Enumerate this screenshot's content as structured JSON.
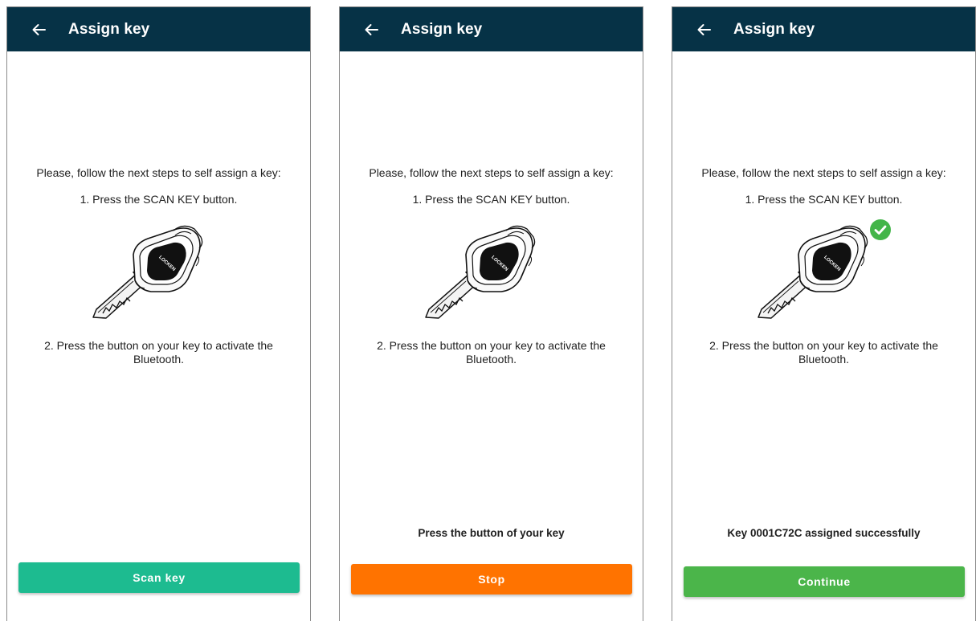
{
  "screens": [
    {
      "title": "Assign key",
      "intro": "Please, follow the next steps to self assign a key:",
      "step1": "1. Press the SCAN KEY button.",
      "step2": "2. Press the button on your key to activate the Bluetooth.",
      "key_brand": "LOCKEN",
      "status": "",
      "button_label": "Scan key"
    },
    {
      "title": "Assign key",
      "intro": "Please, follow the next steps to self assign a key:",
      "step1": "1. Press the SCAN KEY button.",
      "step2": "2. Press the button on your key to activate the Bluetooth.",
      "key_brand": "LOCKEN",
      "status": "Press the button of your key",
      "button_label": "Stop"
    },
    {
      "title": "Assign key",
      "intro": "Please, follow the next steps to self assign a key:",
      "step1": "1. Press the SCAN KEY button.",
      "step2": "2. Press the button on your key to activate the Bluetooth.",
      "key_brand": "LOCKEN",
      "status": "Key 0001C72C assigned successfully",
      "button_label": "Continue"
    }
  ],
  "icons": {
    "back": "arrow-left-icon",
    "key": "key-icon",
    "success": "check-circle-icon"
  },
  "colors": {
    "app_bar": "#063246",
    "scan_button": "#1dbb90",
    "stop_button": "#ff7300",
    "continue_button": "#4bb54a",
    "success_badge": "#43b549"
  }
}
